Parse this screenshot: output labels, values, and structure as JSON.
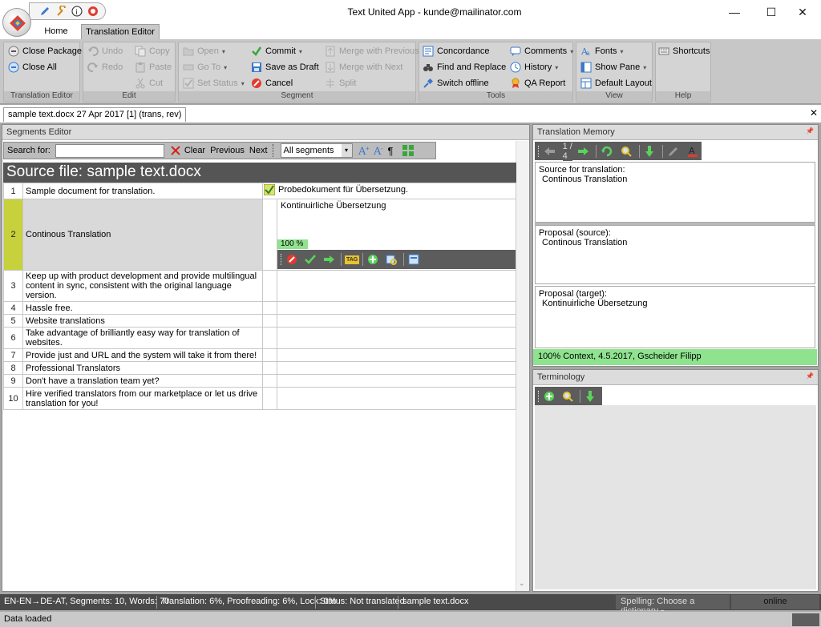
{
  "window": {
    "title": "Text United App - kunde@mailinator.com",
    "minimize": "—",
    "maximize": "☐",
    "close": "✕"
  },
  "ribbon_tabs": [
    "Home",
    "Translation Editor"
  ],
  "ribbon": {
    "groups": {
      "translation_editor": "Translation Editor",
      "edit": "Edit",
      "segment": "Segment",
      "tools": "Tools",
      "view": "View",
      "help": "Help"
    },
    "close_package": "Close Package",
    "close_all": "Close All",
    "undo": "Undo",
    "redo": "Redo",
    "copy": "Copy",
    "paste": "Paste",
    "cut": "Cut",
    "open": "Open",
    "go_to": "Go To",
    "set_status": "Set Status",
    "commit": "Commit",
    "save_as_draft": "Save as Draft",
    "cancel": "Cancel",
    "merge_previous": "Merge with Previous",
    "merge_next": "Merge with Next",
    "split": "Split",
    "concordance": "Concordance",
    "find_replace": "Find and Replace",
    "switch_offline": "Switch offline",
    "comments": "Comments",
    "history": "History",
    "qa_report": "QA Report",
    "fonts": "Fonts",
    "show_pane": "Show Pane",
    "default_layout": "Default Layout",
    "shortcuts": "Shortcuts"
  },
  "doc_tab": {
    "label": "sample text.docx 27 Apr 2017 [1] (trans, rev)",
    "close": "✕"
  },
  "segments_editor": {
    "title": "Segments Editor",
    "search_label": "Search for:",
    "search_value": "",
    "clear": "Clear",
    "previous": "Previous",
    "next": "Next",
    "filter": "All segments",
    "pilcrow": "¶",
    "source_file": "Source file: sample text.docx",
    "active_target": "Kontinuirliche Übersetzung",
    "active_match": "100 %",
    "active_tag": "TAG",
    "segments": [
      {
        "num": "1",
        "source": "Sample document for translation.",
        "target": "Probedokument für Übersetzung."
      },
      {
        "num": "2",
        "source": "Continous Translation",
        "target": "Kontinuirliche Übersetzung"
      },
      {
        "num": "3",
        "source": "Keep up with product development and provide multilingual content in sync, consistent with the original language version.",
        "target": ""
      },
      {
        "num": "4",
        "source": "Hassle free.",
        "target": ""
      },
      {
        "num": "5",
        "source": "Website translations",
        "target": ""
      },
      {
        "num": "6",
        "source": "Take advantage of brilliantly easy way for translation of websites.",
        "target": ""
      },
      {
        "num": "7",
        "source": "Provide just and URL and the system will take it from there!",
        "target": ""
      },
      {
        "num": "8",
        "source": "Professional Translators",
        "target": ""
      },
      {
        "num": "9",
        "source": "Don't have a translation team yet?",
        "target": ""
      },
      {
        "num": "10",
        "source": "Hire verified translators from our marketplace or let us drive translation for you!",
        "target": ""
      }
    ]
  },
  "translation_memory": {
    "title": "Translation Memory",
    "counter": "1 / 4",
    "source_label": "Source for translation:",
    "source_text": "Continous Translation",
    "proposal_source_label": "Proposal (source):",
    "proposal_source_text": "Continous Translation",
    "proposal_target_label": "Proposal (target):",
    "proposal_target_text": "Kontinuirliche Übersetzung",
    "match_info": "100%  Context, 4.5.2017, Gscheider Filipp"
  },
  "terminology": {
    "title": "Terminology"
  },
  "status_bar": {
    "lang": "EN-EN→DE-AT, Segments: 10, Words: 70",
    "progress": "Translation: 6%, Proofreading: 6%, Lock: 0%",
    "status": "Status: Not translated",
    "file": "sample text.docx",
    "spelling": "Spelling:   Choose a dictionary",
    "online": "online"
  },
  "bottom": {
    "message": "Data loaded"
  },
  "colors": {
    "match_green": "#8fe38f",
    "active_row": "#c6d13c",
    "dark_bar": "#555555"
  }
}
